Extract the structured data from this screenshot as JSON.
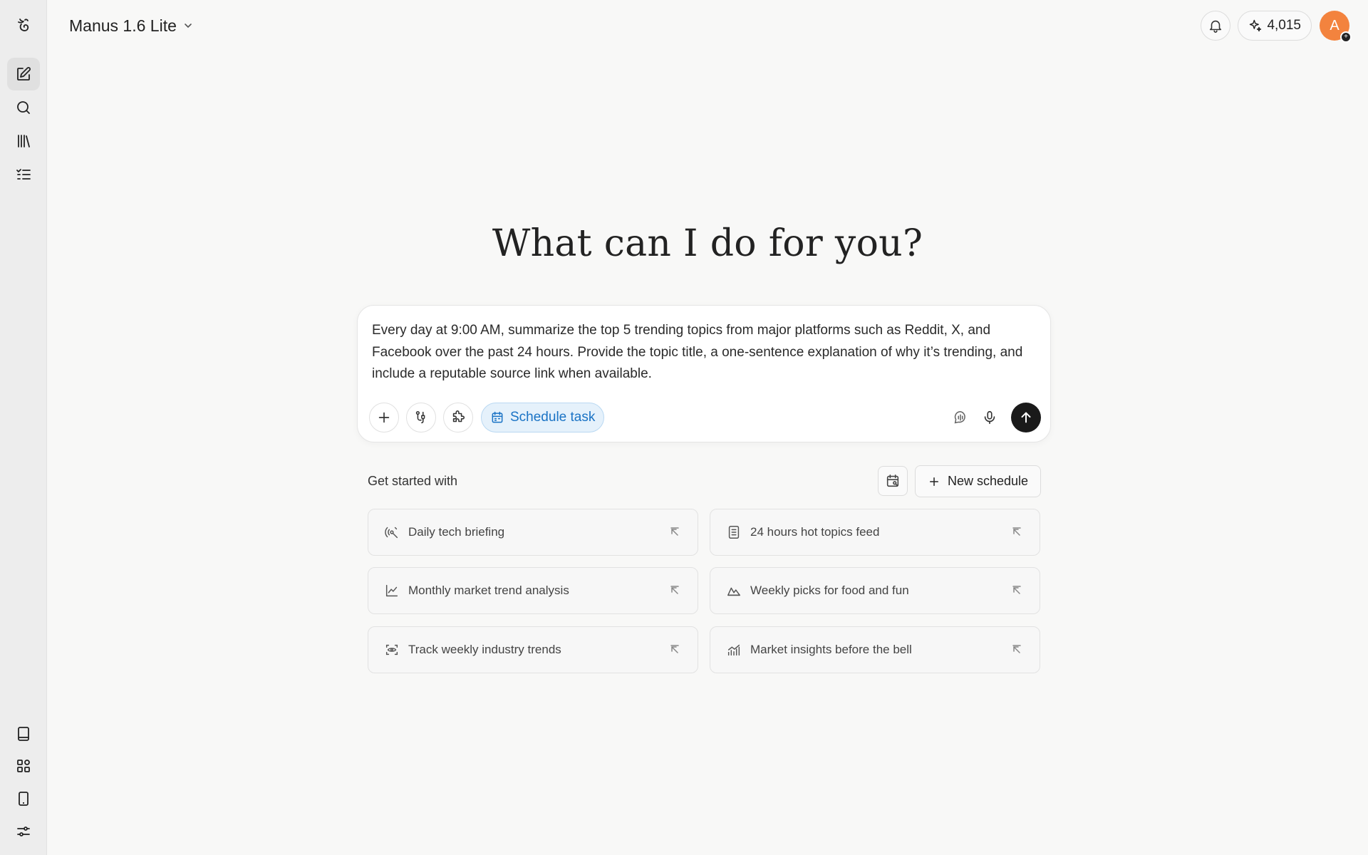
{
  "header": {
    "model_name": "Manus 1.6 Lite",
    "credits": "4,015",
    "avatar_initial": "A"
  },
  "sidebar": {
    "top_items": [
      "new-task-icon",
      "search-icon",
      "library-icon",
      "tasks-list-icon"
    ],
    "bottom_items": [
      "book-icon",
      "apps-grid-icon",
      "mobile-icon",
      "settings-sliders-icon"
    ]
  },
  "hero": {
    "title": "What can I do for you?"
  },
  "composer": {
    "text": "Every day at 9:00 AM, summarize the top 5 trending topics from major platforms such as Reddit, X, and Facebook over the past 24 hours. Provide the topic title, a one-sentence explanation of why it’s trending, and include a reputable source link when available.",
    "schedule_chip_label": "Schedule task",
    "chip_color": "#1a73c5"
  },
  "get_started": {
    "label": "Get started with",
    "new_schedule_label": "New schedule",
    "cards": [
      {
        "label": "Daily tech briefing",
        "icon": "satellite-icon"
      },
      {
        "label": "24 hours hot topics feed",
        "icon": "document-icon"
      },
      {
        "label": "Monthly market trend analysis",
        "icon": "line-chart-icon"
      },
      {
        "label": "Weekly picks for food and fun",
        "icon": "mountain-icon"
      },
      {
        "label": "Track weekly industry trends",
        "icon": "focus-eye-icon"
      },
      {
        "label": "Market insights before the bell",
        "icon": "bar-trend-icon"
      }
    ]
  },
  "colors": {
    "accent": "#1a73c5",
    "avatar": "#f3833e",
    "background": "#f8f8f7"
  }
}
